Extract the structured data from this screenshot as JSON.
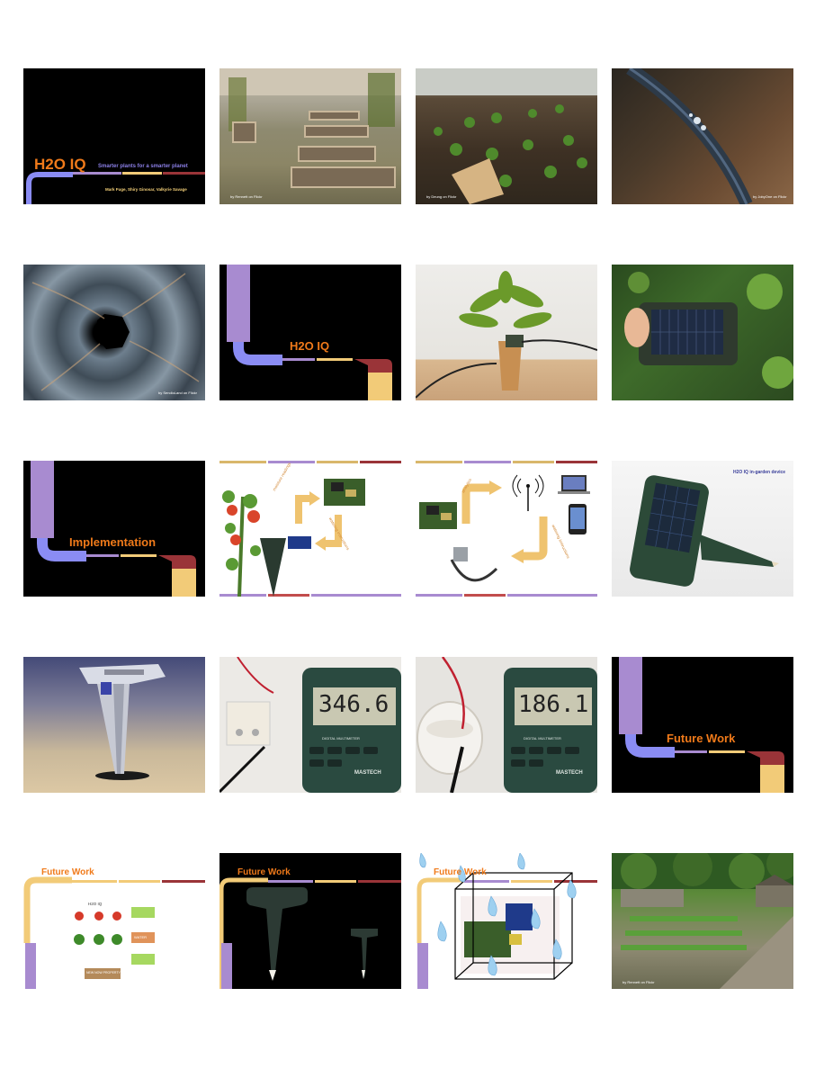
{
  "colors": {
    "orange": "#f07a1a",
    "purple_text": "#8b7fe6",
    "yellow_text": "#f6d27a",
    "bar_purple": "#a88bd0",
    "bar_blue": "#8a8cf4",
    "bar_yellow": "#f2cb78",
    "bar_red": "#9a3438",
    "navy_text": "#3a3f9a"
  },
  "slides": {
    "s1": {
      "title": "H2O IQ",
      "subtitle": "Smarter plants for a smarter planet",
      "authors": "Mark Fuge, Shiry Ginosar, Valkyrie Savage"
    },
    "s2": {
      "credit": "by Rennett on Flickr"
    },
    "s3": {
      "credit": "by Deung on Flickr"
    },
    "s4": {
      "credit": "by JobyOne on Flickr"
    },
    "s5": {
      "credit": "by SendioLand on Flickr"
    },
    "s6": {
      "title": "H2O IQ"
    },
    "s9": {
      "title": "Implementation"
    },
    "s10": {
      "arrow_up_label": "moisture readings",
      "arrow_down_label": "watering instructions"
    },
    "s11": {
      "arrow_up_label": "analytics",
      "arrow_down_label": "watering instructions"
    },
    "s12": {
      "label": "H2O IQ in-garden device"
    },
    "s14": {
      "reading": "346.6",
      "meter_label": "DIGITAL MULTIMETER",
      "brand": "MASTECH"
    },
    "s15": {
      "reading": "186.1",
      "meter_label": "DIGITAL MULTIMETER",
      "brand": "MASTECH"
    },
    "s16": {
      "title": "Future Work"
    },
    "s17": {
      "title": "Future Work",
      "app_title": "H2O IQ",
      "btn_water": "WATER",
      "btn_new": "NEW NOW PROPERTY"
    },
    "s18": {
      "title": "Future Work"
    },
    "s19": {
      "title": "Future Work"
    },
    "s20": {
      "credit": "by Rennett on Flickr"
    }
  }
}
